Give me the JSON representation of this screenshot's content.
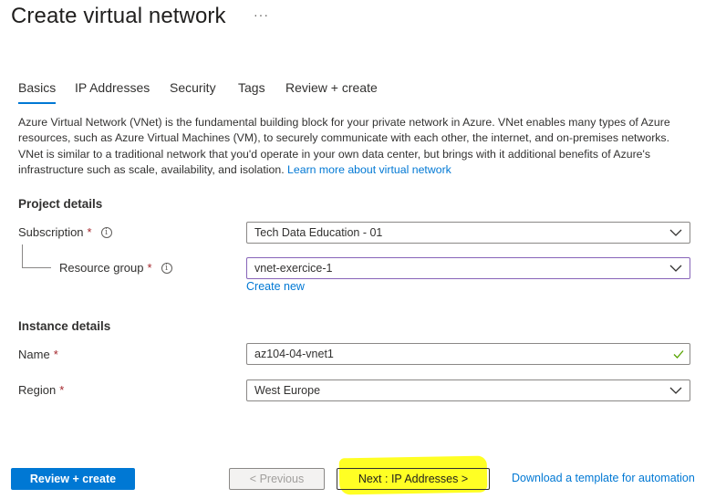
{
  "page": {
    "title": "Create virtual network",
    "more_label": "···"
  },
  "tabs": [
    {
      "label": "Basics",
      "active": true
    },
    {
      "label": "IP Addresses"
    },
    {
      "label": "Security"
    },
    {
      "label": "Tags"
    },
    {
      "label": "Review + create"
    }
  ],
  "description": {
    "text": "Azure Virtual Network (VNet) is the fundamental building block for your private network in Azure. VNet enables many types of Azure resources, such as Azure Virtual Machines (VM), to securely communicate with each other, the internet, and on-premises networks. VNet is similar to a traditional network that you'd operate in your own data center, but brings with it additional benefits of Azure's infrastructure such as scale, availability, and isolation.",
    "link": "Learn more about virtual network"
  },
  "project_details": {
    "heading": "Project details",
    "subscription": {
      "label": "Subscription",
      "required": "*",
      "info": "i",
      "value": "Tech Data Education - 01"
    },
    "resource_group": {
      "label": "Resource group",
      "required": "*",
      "info": "i",
      "value": "vnet-exercice-1",
      "create_new": "Create new"
    }
  },
  "instance_details": {
    "heading": "Instance details",
    "name": {
      "label": "Name",
      "required": "*",
      "value": "az104-04-vnet1"
    },
    "region": {
      "label": "Region",
      "required": "*",
      "value": "West Europe"
    }
  },
  "footer": {
    "review_create": "Review + create",
    "previous": "< Previous",
    "next": "Next : IP Addresses >",
    "download_template": "Download a template for automation"
  },
  "colors": {
    "accent": "#0078d4",
    "required": "#a4262c",
    "focus_border": "#8764b8",
    "valid_check": "#57a300",
    "highlight": "#ffff24"
  }
}
